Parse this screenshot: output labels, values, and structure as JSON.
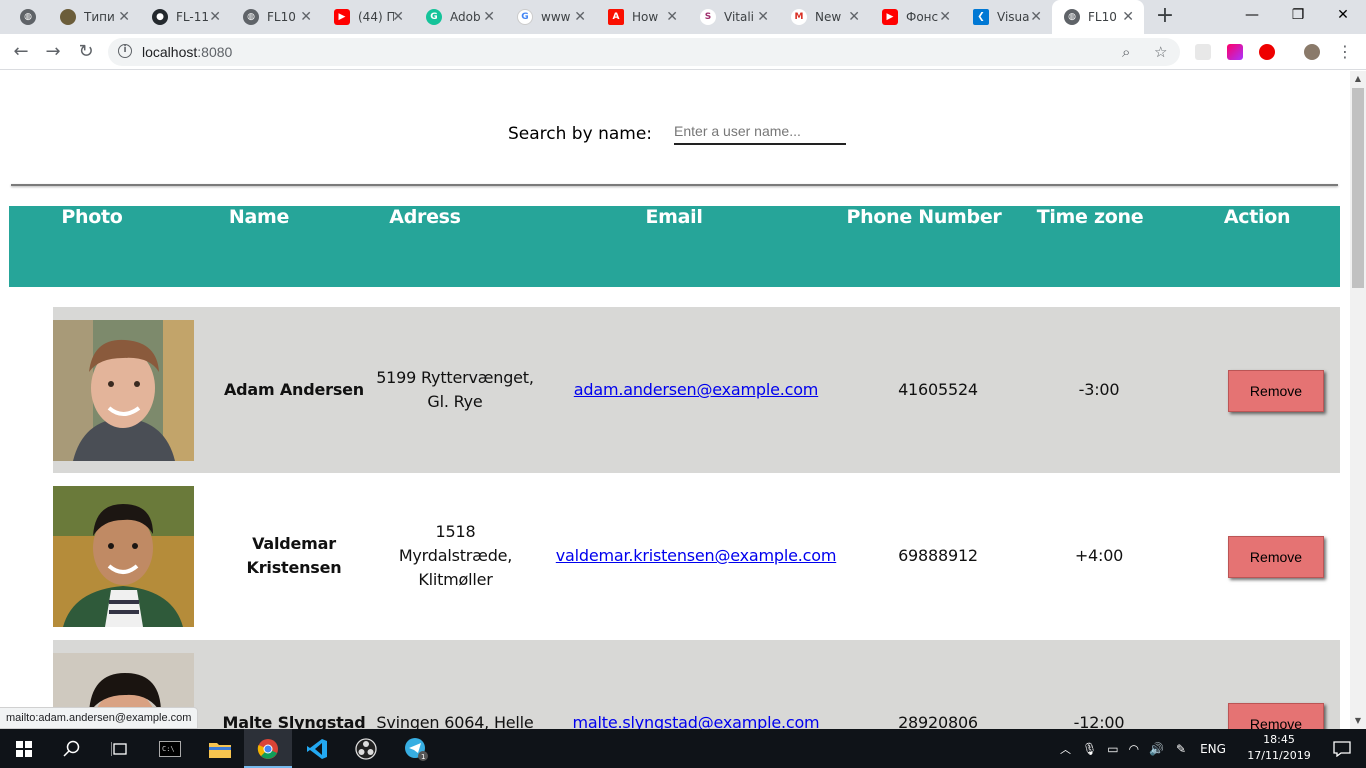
{
  "browser": {
    "tabs": [
      {
        "title": "",
        "favicon": "globe-icon",
        "color": "#5f6368"
      },
      {
        "title": "Типи",
        "favicon": "avatar-icon",
        "color": "#6b5d3a"
      },
      {
        "title": "FL-11",
        "favicon": "github-icon",
        "color": "#24292e"
      },
      {
        "title": "FL10",
        "favicon": "globe-icon",
        "color": "#5f6368"
      },
      {
        "title": "(44) П",
        "favicon": "youtube-icon",
        "color": "#ff0000"
      },
      {
        "title": "Adob",
        "favicon": "grammarly-icon",
        "color": "#15c39a"
      },
      {
        "title": "www",
        "favicon": "google-icon",
        "color": "#4285f4"
      },
      {
        "title": "How",
        "favicon": "adobe-icon",
        "color": "#fa0f00"
      },
      {
        "title": "Vitali",
        "favicon": "slack-icon",
        "color": "#a0306e"
      },
      {
        "title": "New",
        "favicon": "gmail-icon",
        "color": "#d93025"
      },
      {
        "title": "Фонс",
        "favicon": "youtube-icon",
        "color": "#ff0000"
      },
      {
        "title": "Visua",
        "favicon": "vscode-icon",
        "color": "#0078d4"
      },
      {
        "title": "FL10",
        "favicon": "globe-icon",
        "color": "#5f6368"
      }
    ],
    "url_host": "localhost",
    "url_port": ":8080",
    "status_text": "mailto:adam.andersen@example.com"
  },
  "search": {
    "label": "Search by name:",
    "placeholder": "Enter a user name...",
    "value": ""
  },
  "table": {
    "header_color": "#26a599",
    "columns": [
      "Photo",
      "Name",
      "Adress",
      "Email",
      "Phone Number",
      "Time zone",
      "Action"
    ],
    "rows": [
      {
        "name": "Adam Andersen",
        "address": "5199 Ryttervænget, Gl. Rye",
        "email": "adam.andersen@example.com",
        "phone": "41605524",
        "timezone": "-3:00",
        "action": "Remove"
      },
      {
        "name": "Valdemar Kristensen",
        "address": "1518 Myrdalstræde, Klitmøller",
        "email": "valdemar.kristensen@example.com",
        "phone": "69888912",
        "timezone": "+4:00",
        "action": "Remove"
      },
      {
        "name": "Malte Slyngstad",
        "address": "Svingen 6064, Helle",
        "email": "malte.slyngstad@example.com",
        "phone": "28920806",
        "timezone": "-12:00",
        "action": "Remove"
      }
    ]
  },
  "taskbar": {
    "language": "ENG",
    "time": "18:45",
    "date": "17/11/2019",
    "telegram_badge": "1"
  }
}
